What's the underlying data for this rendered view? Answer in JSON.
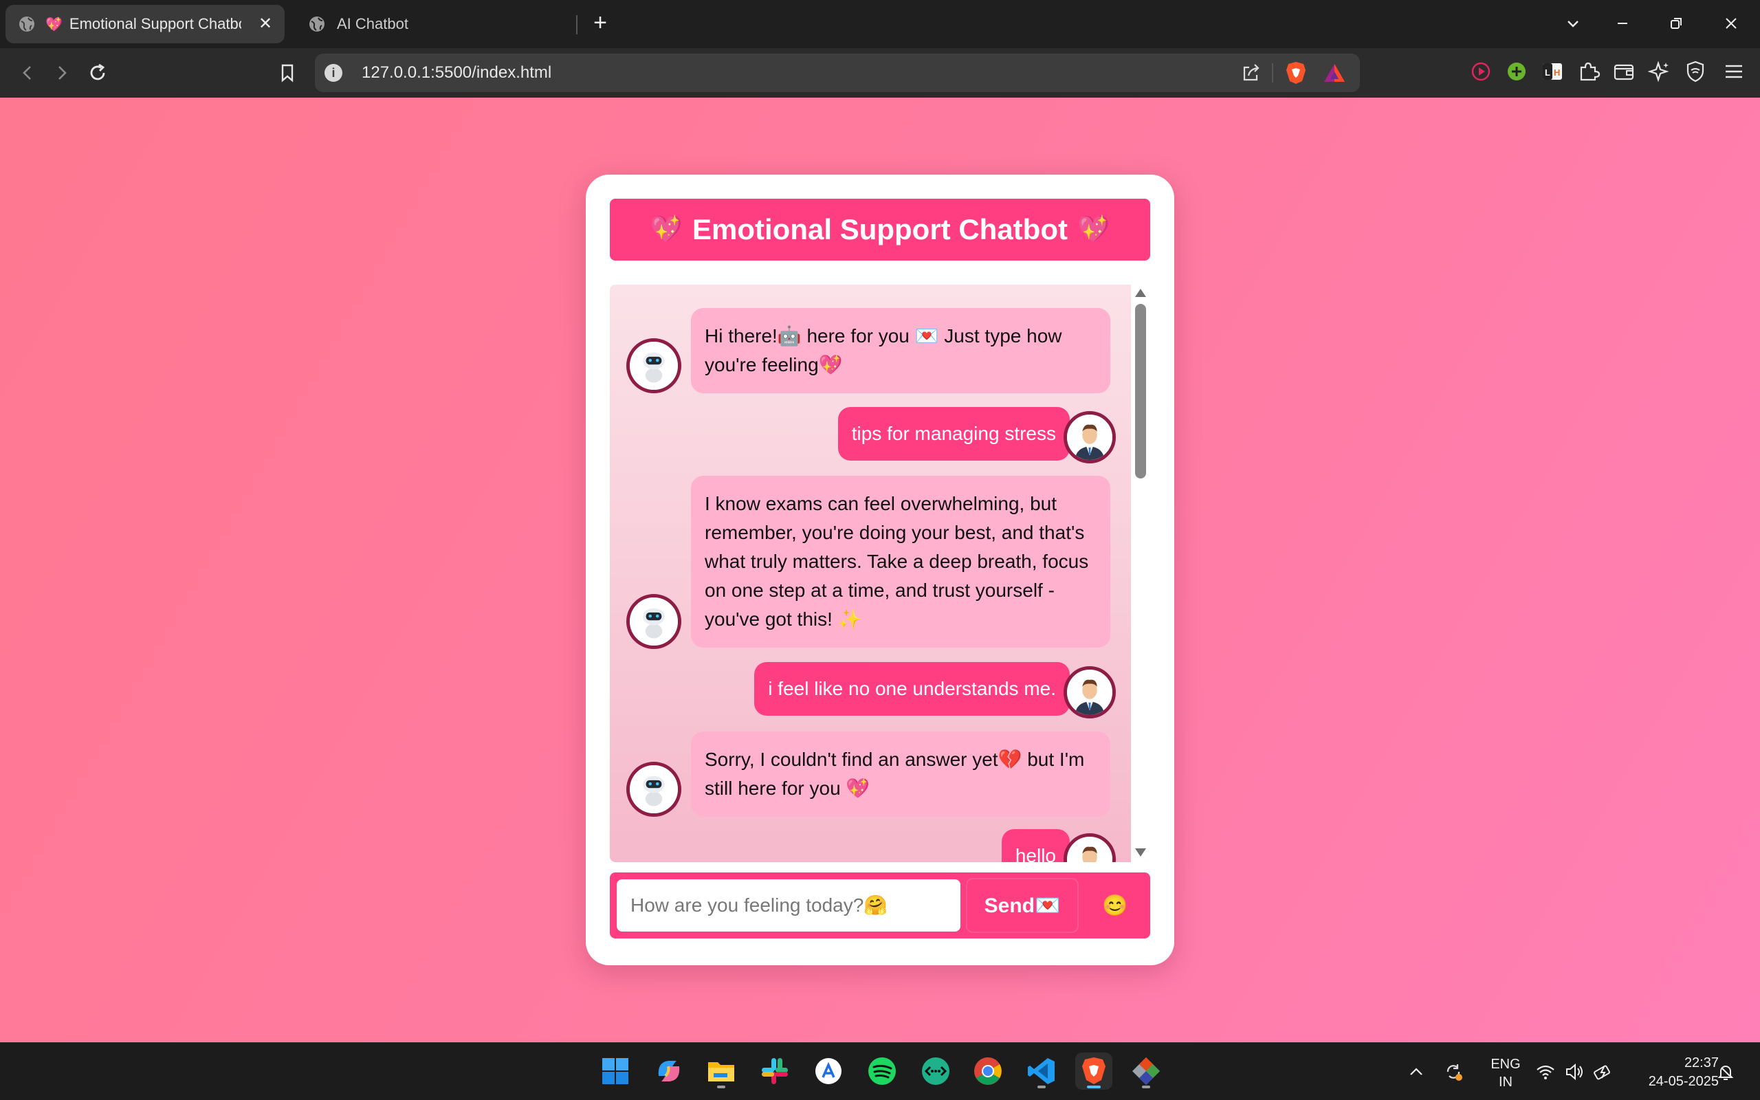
{
  "browser": {
    "tabs": [
      {
        "title": "Emotional Support Chatbot",
        "active": true,
        "favicon": "sparkling-heart"
      },
      {
        "title": "AI Chatbot",
        "active": false,
        "favicon": "globe"
      }
    ],
    "new_tab_label": "+",
    "url": "127.0.0.1:5500/index.html"
  },
  "chat": {
    "header_title": "Emotional Support Chatbot",
    "header_emoji": "💖",
    "messages": [
      {
        "sender": "bot",
        "text": "Hi there!🤖 here for you 💌 Just type how you're feeling💖"
      },
      {
        "sender": "user",
        "text": "tips for managing stress"
      },
      {
        "sender": "bot",
        "text": "I know exams can feel overwhelming, but remember, you're doing your best, and that's what truly matters. Take a deep breath, focus on one step at a time, and trust yourself - you've got this! ✨"
      },
      {
        "sender": "user",
        "text": "i feel like no one understands me."
      },
      {
        "sender": "bot",
        "text": "Sorry, I couldn't find an answer yet💔 but I'm still here for you 💖"
      },
      {
        "sender": "user",
        "text": "hello"
      }
    ],
    "input_placeholder": "How are you feeling today?🤗",
    "send_label": "Send💌",
    "emoji_button": "😊"
  },
  "taskbar": {
    "apps": [
      "start",
      "copilot",
      "file-explorer",
      "slack",
      "app-store",
      "spotify",
      "remote-desktop",
      "chrome",
      "vscode",
      "brave",
      "git"
    ],
    "language_line1": "ENG",
    "language_line2": "IN",
    "time": "22:37",
    "date": "24-05-2025"
  },
  "colors": {
    "accent": "#ff3e82",
    "bot_bubble": "#ffb1cd",
    "avatar_ring": "#8e1d46"
  }
}
